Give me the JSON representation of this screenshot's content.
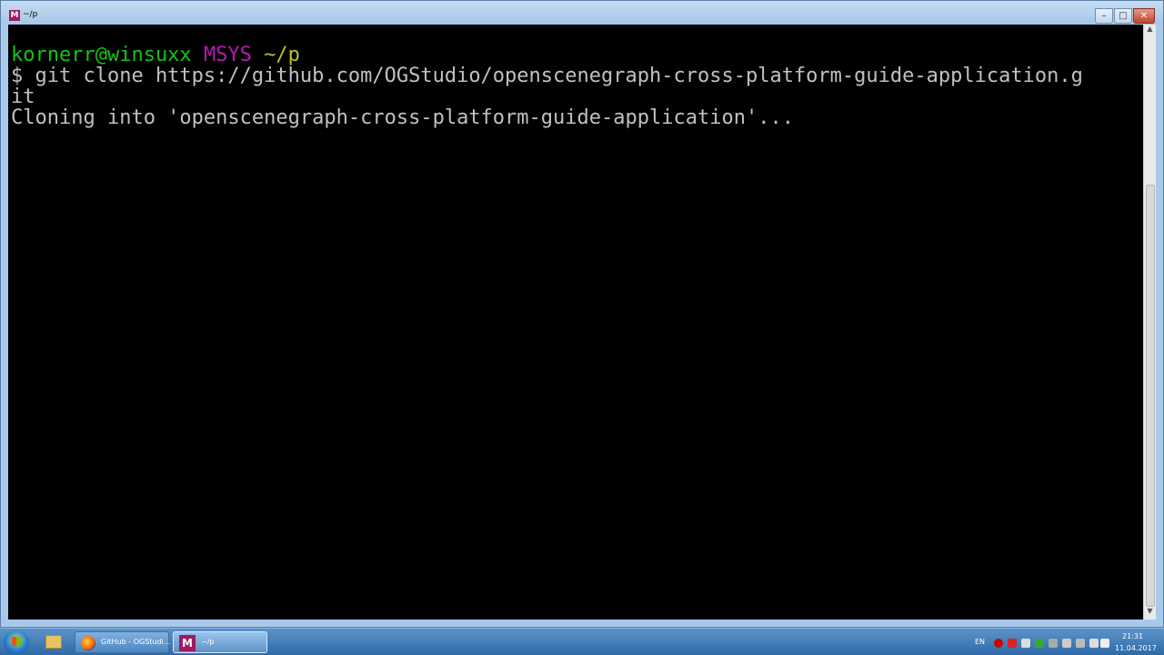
{
  "window": {
    "title": "~/p",
    "icon_name": "msys-icon",
    "buttons": {
      "minimize": "–",
      "maximize": "□",
      "close": "✕"
    }
  },
  "terminal": {
    "prompt": {
      "user_host": "kornerr@winsuxx",
      "system": "MSYS",
      "path": "~/p"
    },
    "command_line_1": "$ git clone https://github.com/OGStudio/openscenegraph-cross-platform-guide-application.g",
    "command_line_2": "it",
    "output_line": "Cloning into 'openscenegraph-cross-platform-guide-application'...",
    "colors": {
      "user_host": "#15c215",
      "system": "#b51ab5",
      "path": "#bfbf2c",
      "text": "#c0c0c0",
      "background": "#000000"
    }
  },
  "scrollbar": {
    "up_arrow": "▲",
    "down_arrow": "▼"
  },
  "taskbar": {
    "items": [
      {
        "name": "explorer",
        "icon": "folder-icon",
        "label": ""
      },
      {
        "name": "firefox",
        "icon": "firefox-icon",
        "label": "GitHub - OGStudi..."
      },
      {
        "name": "msys",
        "icon": "msys-icon",
        "label": "~/p"
      }
    ],
    "tray": {
      "language": "EN",
      "time": "21:31",
      "date": "11.04.2017"
    }
  }
}
